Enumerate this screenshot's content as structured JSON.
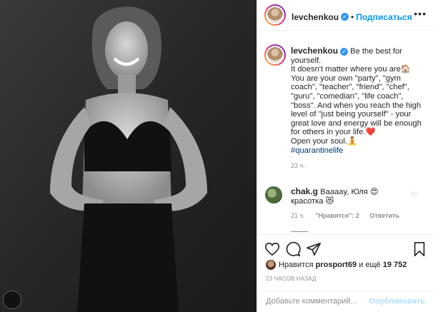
{
  "post": {
    "username": "levchenkou",
    "follow_label": "Подписаться",
    "dot": "•",
    "more": "•••"
  },
  "caption": {
    "username": "levchenkou",
    "lines": [
      "Be the best for",
      "yourself.",
      "It doesn't matter where you are🏠",
      "You are your own \"party\", \"gym",
      "coach\", \"teacher\", \"friend\", \"chef\",",
      "\"guru\", \"comedian\", \"life coach\",",
      "\"boss\". And when you reach the high",
      "level of \"just being yourself\" - your",
      "great love and energy will be enough",
      "for others in your life.❤️",
      "Open your soul.🧘",
      "#quarantinelife"
    ],
    "time": "23 ч."
  },
  "comment": {
    "username": "chak.g",
    "text_line1": "Вааааy, Юля 😍",
    "text_line2": "красотка 😻",
    "time": "21 ч.",
    "likes": "\"Нравится\": 2",
    "reply": "Ответить"
  },
  "likes": {
    "prefix": "Нравится",
    "user": "prosport69",
    "middle": "и ещё",
    "count": "19 752"
  },
  "post_time": "23 ЧАСОВ НАЗАД",
  "add_comment": {
    "placeholder": "Добавьте комментарий...",
    "publish": "Опубликовать"
  },
  "icons": {
    "verified": "verified-badge-icon",
    "heart": "heart-icon",
    "comment": "comment-icon",
    "share": "share-icon",
    "save": "bookmark-icon"
  },
  "colors": {
    "link_blue": "#0095f6",
    "hashtag": "#00376b",
    "muted": "#8e8e8e",
    "publish_disabled": "#b2dffc"
  }
}
